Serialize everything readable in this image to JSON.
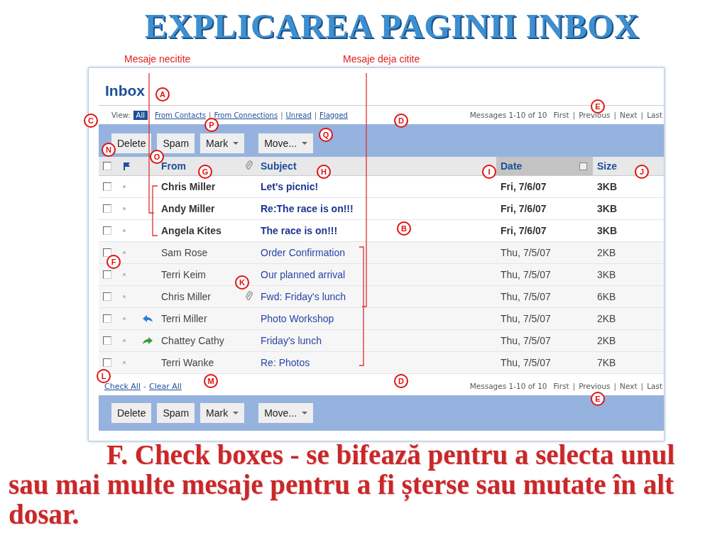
{
  "title": "EXPLICAREA PAGINII INBOX",
  "annotations": {
    "unread_label": "Mesaje necitite",
    "read_label": "Mesaje deja citite"
  },
  "inbox": {
    "heading": "Inbox",
    "view_label": "View:",
    "view_filters": [
      {
        "label": "All",
        "selected": true
      },
      {
        "label": "From Contacts",
        "selected": false
      },
      {
        "label": "From Connections",
        "selected": false
      },
      {
        "label": "Unread",
        "selected": false
      },
      {
        "label": "Flagged",
        "selected": false
      }
    ],
    "separator": "|",
    "pagination_top": {
      "summary": "Messages 1-10 of 10",
      "links": [
        "First",
        "Previous",
        "Next",
        "Last"
      ]
    },
    "toolbar_top": [
      {
        "label": "Delete",
        "kind": "button"
      },
      {
        "label": "Spam",
        "kind": "button"
      },
      {
        "label": "Mark",
        "kind": "menu"
      },
      {
        "label": "Move...",
        "kind": "menu"
      }
    ],
    "columns": [
      {
        "kind": "checkbox",
        "checked": false
      },
      {
        "kind": "flag"
      },
      {
        "kind": "status"
      },
      {
        "kind": "text",
        "label": "From",
        "sorted": false
      },
      {
        "kind": "attachment"
      },
      {
        "kind": "text",
        "label": "Subject",
        "sorted": false
      },
      {
        "kind": "text",
        "label": "Date",
        "sorted": true
      },
      {
        "kind": "text",
        "label": "Size",
        "sorted": false
      }
    ],
    "rows": [
      {
        "checked": false,
        "unread": true,
        "replied": false,
        "forwarded": false,
        "from": "Chris Miller",
        "attachment": false,
        "subject": "Let's picnic!",
        "date": "Fri, 7/6/07",
        "size": "3KB"
      },
      {
        "checked": false,
        "unread": true,
        "replied": false,
        "forwarded": false,
        "from": "Andy Miller",
        "attachment": false,
        "subject": "Re:The race is on!!!",
        "date": "Fri, 7/6/07",
        "size": "3KB"
      },
      {
        "checked": false,
        "unread": true,
        "replied": false,
        "forwarded": false,
        "from": "Angela Kites",
        "attachment": false,
        "subject": "The race is on!!!",
        "date": "Fri, 7/6/07",
        "size": "3KB"
      },
      {
        "checked": false,
        "unread": false,
        "replied": false,
        "forwarded": false,
        "from": "Sam Rose",
        "attachment": false,
        "subject": "Order Confirmation",
        "date": "Thu, 7/5/07",
        "size": "2KB"
      },
      {
        "checked": false,
        "unread": false,
        "replied": false,
        "forwarded": false,
        "from": "Terri Keim",
        "attachment": false,
        "subject": "Our planned arrival",
        "date": "Thu, 7/5/07",
        "size": "3KB"
      },
      {
        "checked": false,
        "unread": false,
        "replied": false,
        "forwarded": false,
        "from": "Chris Miller",
        "attachment": true,
        "subject": "Fwd: Friday's lunch",
        "date": "Thu, 7/5/07",
        "size": "6KB"
      },
      {
        "checked": false,
        "unread": false,
        "replied": true,
        "forwarded": false,
        "from": "Terri Miller",
        "attachment": false,
        "subject": "Photo Workshop",
        "date": "Thu, 7/5/07",
        "size": "2KB"
      },
      {
        "checked": false,
        "unread": false,
        "replied": false,
        "forwarded": true,
        "from": "Chattey Cathy",
        "attachment": false,
        "subject": "Friday's lunch",
        "date": "Thu, 7/5/07",
        "size": "2KB"
      },
      {
        "checked": false,
        "unread": false,
        "replied": false,
        "forwarded": false,
        "from": "Terri Wanke",
        "attachment": false,
        "subject": "Re: Photos",
        "date": "Thu, 7/5/07",
        "size": "7KB"
      }
    ],
    "check_all": "Check All",
    "dash": "-",
    "clear_all": "Clear All",
    "pagination_bottom": {
      "summary": "Messages 1-10 of 10",
      "links": [
        "First",
        "Previous",
        "Next",
        "Last"
      ]
    },
    "toolbar_bottom": [
      {
        "label": "Delete",
        "kind": "button"
      },
      {
        "label": "Spam",
        "kind": "button"
      },
      {
        "label": "Mark",
        "kind": "menu"
      },
      {
        "label": "Move...",
        "kind": "menu"
      }
    ]
  },
  "callouts": [
    "A",
    "C",
    "D",
    "E",
    "P",
    "Q",
    "N",
    "O",
    "G",
    "H",
    "I",
    "J",
    "B",
    "F",
    "K",
    "L",
    "M",
    "D",
    "E"
  ],
  "caption": "F. **Check boxes** - se bifează pentru a selecta unul sau mai multe mesaje pentru a fi șterse sau mutate în alt dosar."
}
